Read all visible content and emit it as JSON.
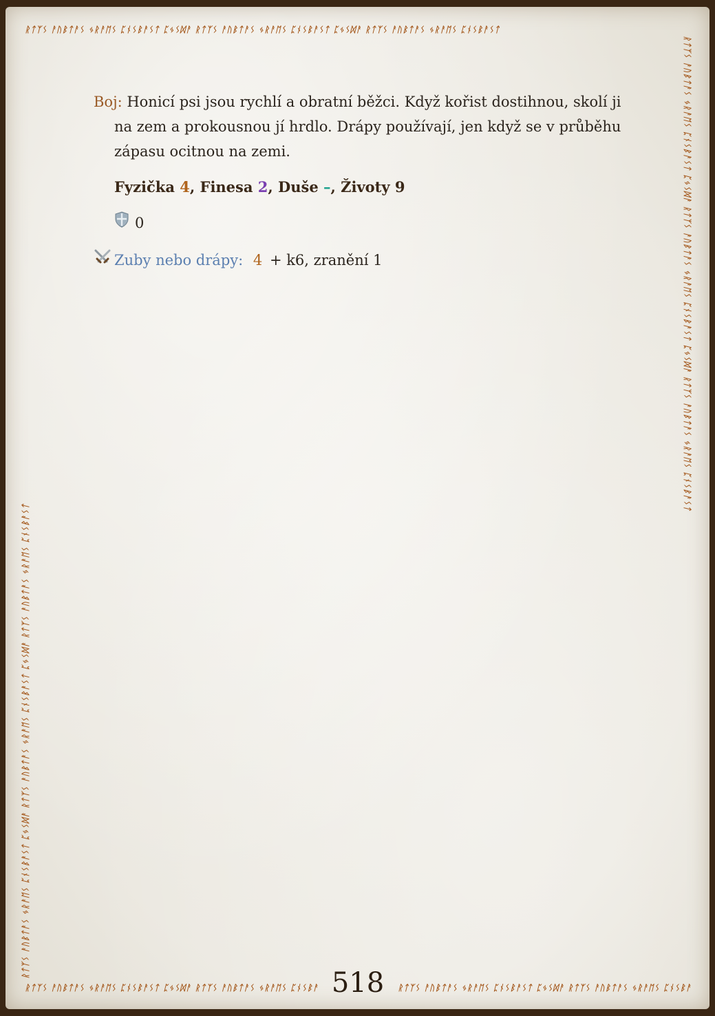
{
  "border": {
    "rune_text": "ᚱᛏᛉᛊ ᚨᚢᛒᛏᚨᛊ ᛃᚱᚨᛖᛊ ᛈᚾᛊᛒᚨᛊᛏ ᛈᛃᛊᛞᚨ ᚱᛏᛉᛊ ᚨᚢᛒᛏᚨᛊ ᛃᚱᚨᛖᛊ ᛈᚾᛊᛒᚨᛊᛏ ᛈᛃᛊᛞᚨ ᚱᛏᛉᛊ ᚨᚢᛒᛏᚨᛊ ᛃᚱᚨᛖᛊ ᛈᚾᛊᛒᚨᛊᛏ",
    "color": "#a4581c"
  },
  "combat": {
    "label": "Boj:",
    "text": " Honicí psi jsou rychlí a obratní běžci. Když kořist dostihnou, skolí ji na zem a prokousnou jí hrdlo. Drápy používají, jen když se v průběhu zápasu ocitnou na zemi."
  },
  "stats": {
    "physique_label": "Fyzička ",
    "physique_value": "4",
    "sep1": ", ",
    "finesse_label": "Finesa ",
    "finesse_value": "2",
    "sep2": ", ",
    "soul_label": "Duše ",
    "soul_value": "–",
    "sep3": ", ",
    "hp_label": "Životy 9"
  },
  "armor": {
    "icon": "shield-icon",
    "value": "0"
  },
  "attack": {
    "icon": "crossed-swords-icon",
    "name": "Zuby nebo drápy:",
    "bonus": "4",
    "rest": " + k6, zranění 1"
  },
  "page_number": "518"
}
